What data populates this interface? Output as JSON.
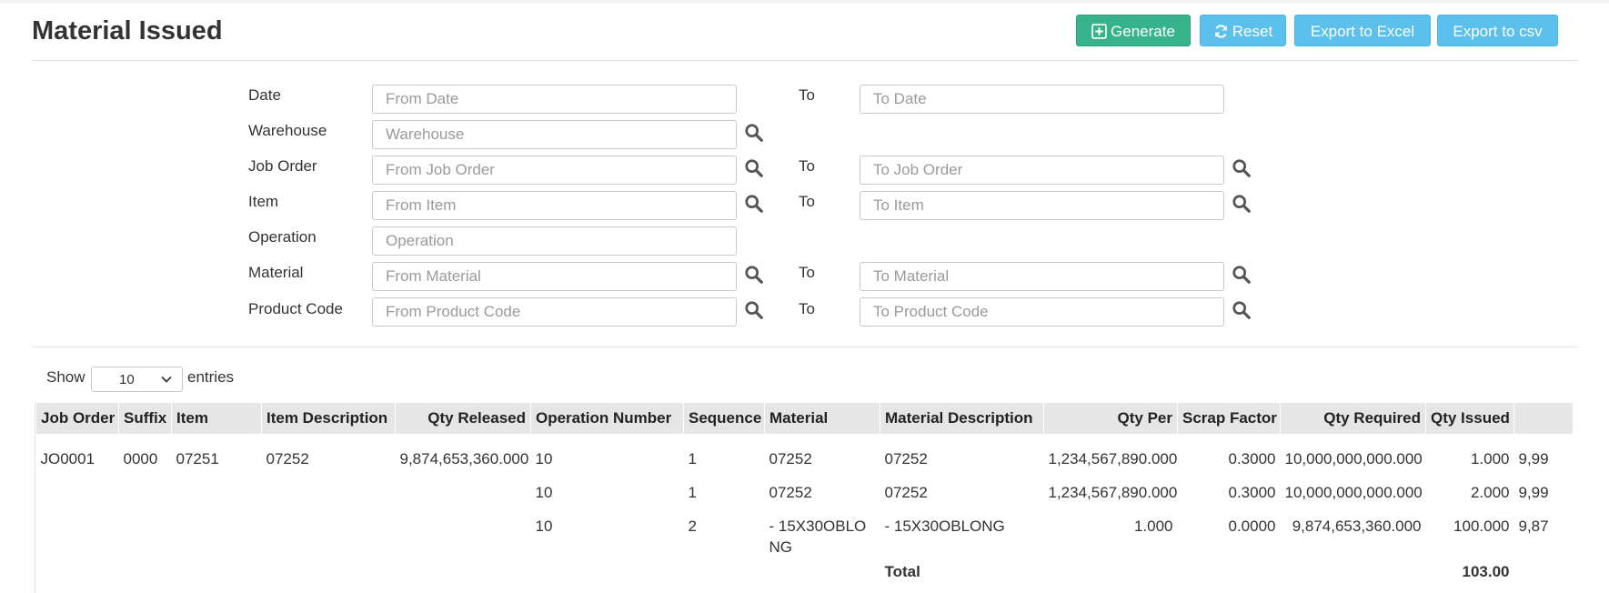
{
  "page": {
    "title": "Material Issued"
  },
  "toolbar": {
    "generate_label": "Generate",
    "reset_label": "Reset",
    "export_excel_label": "Export to Excel",
    "export_csv_label": "Export to csv"
  },
  "filters": {
    "date": {
      "label": "Date",
      "from_placeholder": "From Date",
      "to_label": "To",
      "to_placeholder": "To Date"
    },
    "warehouse": {
      "label": "Warehouse",
      "placeholder": "Warehouse"
    },
    "job_order": {
      "label": "Job Order",
      "from_placeholder": "From Job Order",
      "to_label": "To",
      "to_placeholder": "To Job Order"
    },
    "item": {
      "label": "Item",
      "from_placeholder": "From Item",
      "to_label": "To",
      "to_placeholder": "To Item"
    },
    "operation": {
      "label": "Operation",
      "placeholder": "Operation"
    },
    "material": {
      "label": "Material",
      "from_placeholder": "From Material",
      "to_label": "To",
      "to_placeholder": "To Material"
    },
    "product_code": {
      "label": "Product Code",
      "from_placeholder": "From Product Code",
      "to_label": "To",
      "to_placeholder": "To Product Code"
    }
  },
  "table_controls": {
    "show_label": "Show",
    "page_length": "10",
    "entries_label": "entries"
  },
  "table": {
    "columns": [
      "Job Order",
      "Suffix",
      "Item",
      "Item Description",
      "Qty Released",
      "Operation Number",
      "Sequence",
      "Material",
      "Material Description",
      "Qty Per",
      "Scrap Factor",
      "Qty Required",
      "Qty Issued",
      ""
    ],
    "rows": [
      [
        "JO0001",
        "0000",
        "07251",
        "07252",
        "9,874,653,360.000",
        "10",
        "1",
        "07252",
        "07252",
        "1,234,567,890.000",
        "0.3000",
        "10,000,000,000.000",
        "1.000",
        "9,99"
      ],
      [
        "",
        "",
        "",
        "",
        "",
        "10",
        "1",
        "07252",
        "07252",
        "1,234,567,890.000",
        "0.3000",
        "10,000,000,000.000",
        "2.000",
        "9,99"
      ],
      [
        "",
        "",
        "",
        "",
        "",
        "10",
        "2",
        "- 15X30OBLONG",
        "- 15X30OBLONG",
        "1.000",
        "0.0000",
        "9,874,653,360.000",
        "100.000",
        "9,87"
      ]
    ],
    "total_label": "Total",
    "total_value": "103.00"
  },
  "colors": {
    "generate": "#37b38b",
    "reset": "#5bc0eb",
    "export": "#5bc0eb",
    "header_bg": "#e6e6e6"
  },
  "icons": {
    "generate": "plus-square-icon",
    "reset": "refresh-icon",
    "lookup": "search-icon",
    "select": "chevron-down-icon"
  }
}
